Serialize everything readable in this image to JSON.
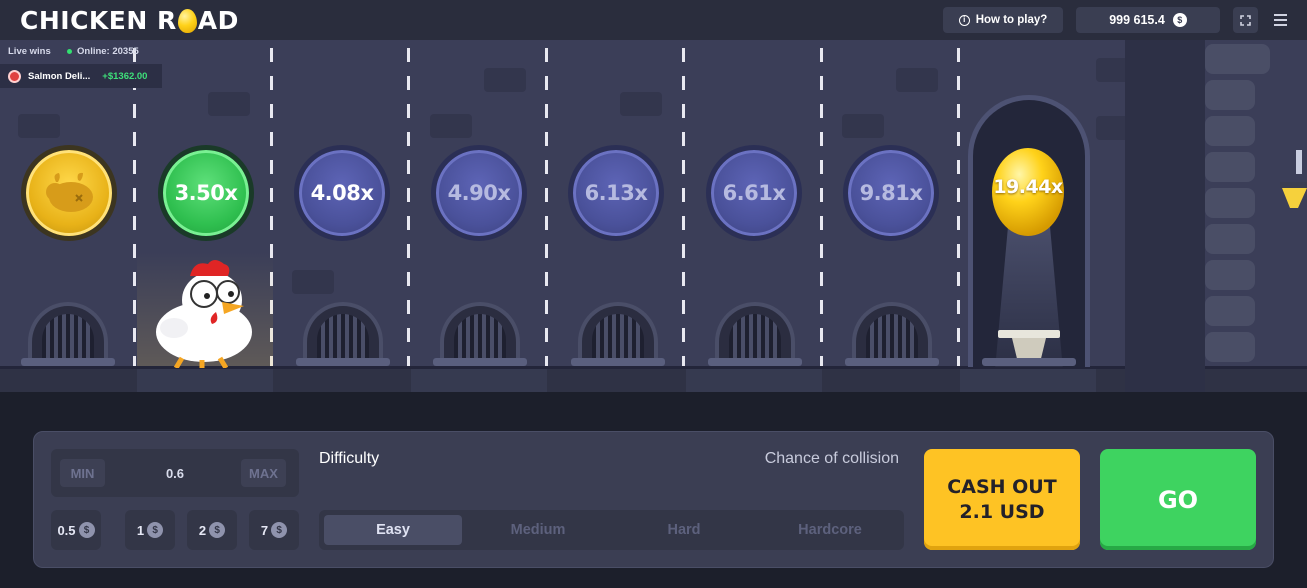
{
  "header": {
    "logo_part1": "CHICKEN R",
    "logo_part2": "AD",
    "how_to_play_label": "How to play?",
    "balance": "999 615.4",
    "currency_symbol": "$"
  },
  "live_wins": {
    "title": "Live wins",
    "online_label": "Online: 20355",
    "latest_win": {
      "name": "Salmon Deli...",
      "amount": "+$1362.00"
    }
  },
  "road": {
    "lanes": [
      {
        "multiplier": "",
        "state": "start"
      },
      {
        "multiplier": "3.50x",
        "state": "passed"
      },
      {
        "multiplier": "4.08x",
        "state": "next"
      },
      {
        "multiplier": "4.90x",
        "state": "upcoming"
      },
      {
        "multiplier": "6.13x",
        "state": "upcoming"
      },
      {
        "multiplier": "6.61x",
        "state": "upcoming"
      },
      {
        "multiplier": "9.81x",
        "state": "upcoming"
      },
      {
        "multiplier": "19.44x",
        "state": "finish"
      }
    ]
  },
  "controls": {
    "min_label": "MIN",
    "bet_value": "0.6",
    "max_label": "MAX",
    "quick_bets": [
      "0.5",
      "1",
      "2",
      "7"
    ],
    "difficulty_label": "Difficulty",
    "chance_label": "Chance of collision",
    "difficulties": [
      "Easy",
      "Medium",
      "Hard",
      "Hardcore"
    ],
    "selected_difficulty": "Easy",
    "cashout_line1": "CASH OUT",
    "cashout_line2": "2.1 USD",
    "go_label": "GO"
  },
  "colors": {
    "accent_yellow": "#fec324",
    "accent_green": "#3ed360",
    "win_green": "#3ee07a"
  }
}
